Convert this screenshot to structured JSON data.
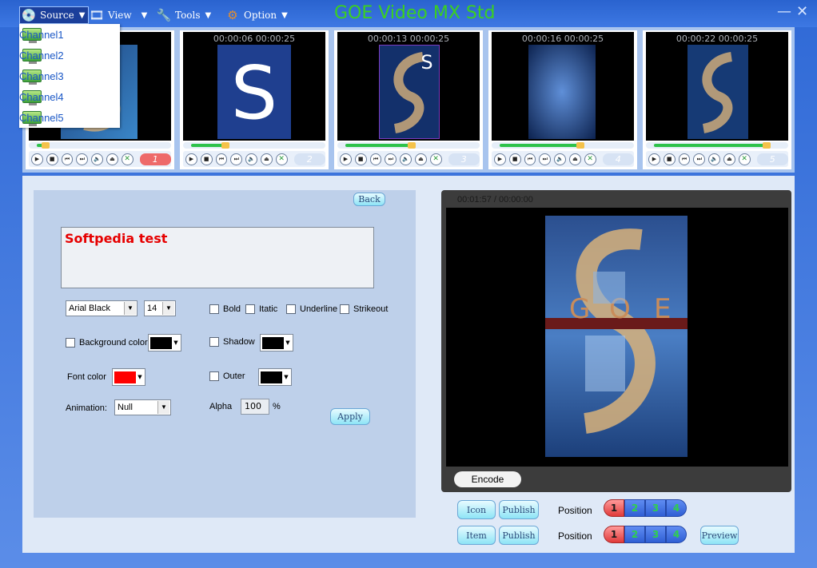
{
  "app": {
    "title": "GOE Video MX Std"
  },
  "menu": [
    {
      "label": "Source",
      "icon": "source-disc-icon",
      "active": true
    },
    {
      "label": "View",
      "icon": "view-film-icon"
    },
    {
      "label": "Tools",
      "icon": "tools-wrench-icon"
    },
    {
      "label": "Option",
      "icon": "option-gear-icon"
    }
  ],
  "window_controls": {
    "minimize": "—",
    "close": "✕"
  },
  "source_dropdown": [
    "Channel1",
    "Channel2",
    "Channel3",
    "Channel4",
    "Channel5"
  ],
  "channels": [
    {
      "time": "",
      "number": "1",
      "active": true,
      "progress": 0.1
    },
    {
      "time": "00:00:06 00:00:25",
      "number": "2",
      "active": false,
      "progress": 0.28
    },
    {
      "time": "00:00:13 00:00:25",
      "number": "3",
      "active": false,
      "progress": 0.5
    },
    {
      "time": "00:00:16 00:00:25",
      "number": "4",
      "active": false,
      "progress": 0.62
    },
    {
      "time": "00:00:22 00:00:25",
      "number": "5",
      "active": false,
      "progress": 0.86
    }
  ],
  "editor": {
    "back_label": "Back",
    "text_value": "Softpedia test",
    "font_name": "Arial Black",
    "font_size": "14",
    "bold_label": "Bold",
    "italic_label": "Itatic",
    "underline_label": "Underline",
    "strikeout_label": "Strikeout",
    "bg_color_label": "Background color",
    "bg_color": "#000000",
    "shadow_label": "Shadow",
    "shadow_color": "#000000",
    "font_color_label": "Font color",
    "font_color": "#ff0000",
    "outer_label": "Outer",
    "outer_color": "#000000",
    "animation_label": "Animation:",
    "animation_value": "Null",
    "alpha_label": "Alpha",
    "alpha_value": "100",
    "alpha_unit": "%",
    "apply_label": "Apply"
  },
  "preview": {
    "time": "00:01:57 / 00:00:00",
    "encode_label": "Encode"
  },
  "publish_rows": [
    {
      "type_label": "Icon",
      "publish_label": "Publish",
      "position_label": "Position",
      "positions": [
        "1",
        "2",
        "3",
        "4"
      ],
      "selected": "1"
    },
    {
      "type_label": "Item",
      "publish_label": "Publish",
      "position_label": "Position",
      "positions": [
        "1",
        "2",
        "3",
        "4"
      ],
      "selected": "1"
    }
  ],
  "preview_button_label": "Preview"
}
